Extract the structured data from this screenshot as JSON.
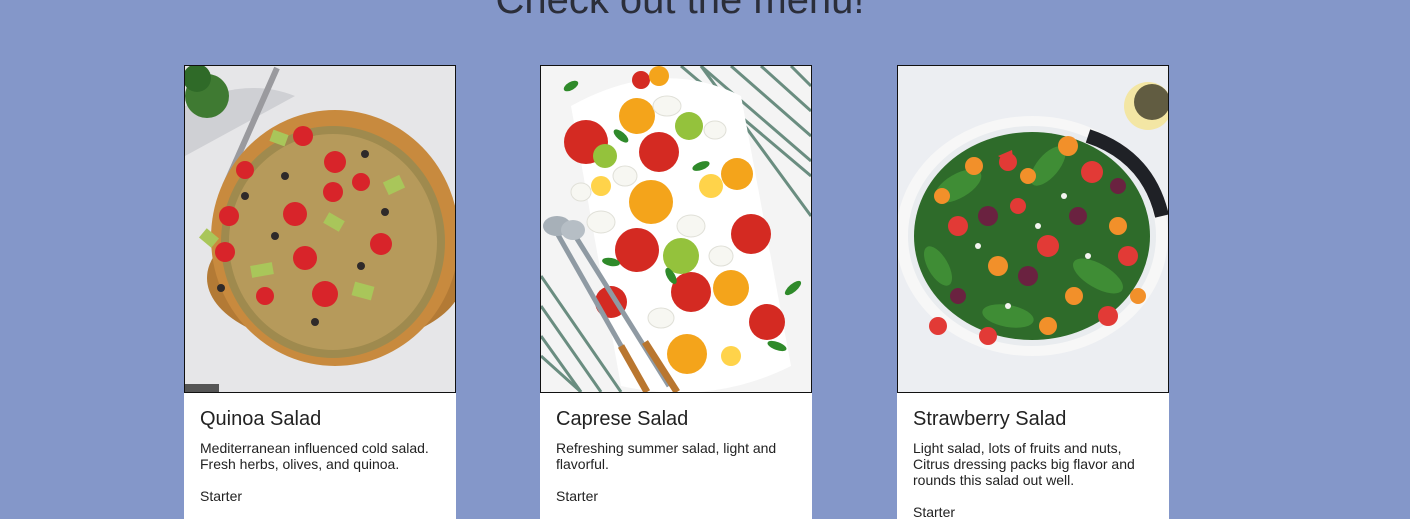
{
  "page": {
    "heading": "Check out the menu!"
  },
  "menu": {
    "items": [
      {
        "title": "Quinoa Salad",
        "description": "Mediterranean influenced cold salad. Fresh herbs, olives, and quinoa.",
        "category": "Starter",
        "image": "quinoa-salad-photo"
      },
      {
        "title": "Caprese Salad",
        "description": "Refreshing summer salad, light and flavorful.",
        "category": "Starter",
        "image": "caprese-salad-photo"
      },
      {
        "title": "Strawberry Salad",
        "description": "Light salad, lots of fruits and nuts, Citrus dressing packs big flavor and rounds this salad out well.",
        "category": "Starter",
        "image": "strawberry-salad-photo"
      }
    ]
  },
  "colors": {
    "background": "#8497c9",
    "card": "#ffffff",
    "text": "#222222"
  }
}
